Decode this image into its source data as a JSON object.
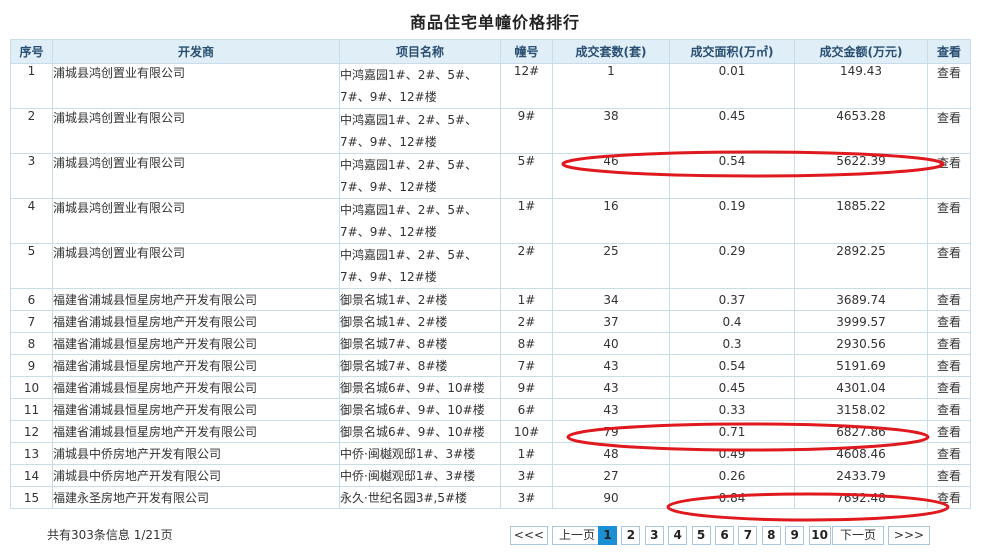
{
  "page_title": "商品住宅单幢价格排行",
  "columns": [
    "序号",
    "开发商",
    "项目名称",
    "幢号",
    "成交套数(套)",
    "成交面积(万㎡)",
    "成交金额(万元)",
    "查看"
  ],
  "rows": [
    {
      "no": "1",
      "developer": "浦城县鸿创置业有限公司",
      "project_line1": "中鸿嘉园1#、2#、5#、",
      "project_line2": "7#、9#、12#楼",
      "building": "12#",
      "units": "1",
      "area": "0.01",
      "amount": "149.43",
      "view": "查看"
    },
    {
      "no": "2",
      "developer": "浦城县鸿创置业有限公司",
      "project_line1": "中鸿嘉园1#、2#、5#、",
      "project_line2": "7#、9#、12#楼",
      "building": "9#",
      "units": "38",
      "area": "0.45",
      "amount": "4653.28",
      "view": "查看"
    },
    {
      "no": "3",
      "developer": "浦城县鸿创置业有限公司",
      "project_line1": "中鸿嘉园1#、2#、5#、",
      "project_line2": "7#、9#、12#楼",
      "building": "5#",
      "units": "46",
      "area": "0.54",
      "amount": "5622.39",
      "view": "查看"
    },
    {
      "no": "4",
      "developer": "浦城县鸿创置业有限公司",
      "project_line1": "中鸿嘉园1#、2#、5#、",
      "project_line2": "7#、9#、12#楼",
      "building": "1#",
      "units": "16",
      "area": "0.19",
      "amount": "1885.22",
      "view": "查看"
    },
    {
      "no": "5",
      "developer": "浦城县鸿创置业有限公司",
      "project_line1": "中鸿嘉园1#、2#、5#、",
      "project_line2": "7#、9#、12#楼",
      "building": "2#",
      "units": "25",
      "area": "0.29",
      "amount": "2892.25",
      "view": "查看"
    },
    {
      "no": "6",
      "developer": "福建省浦城县恒星房地产开发有限公司",
      "project_line1": "御景名城1#、2#楼",
      "project_line2": "",
      "building": "1#",
      "units": "34",
      "area": "0.37",
      "amount": "3689.74",
      "view": "查看"
    },
    {
      "no": "7",
      "developer": "福建省浦城县恒星房地产开发有限公司",
      "project_line1": "御景名城1#、2#楼",
      "project_line2": "",
      "building": "2#",
      "units": "37",
      "area": "0.4",
      "amount": "3999.57",
      "view": "查看"
    },
    {
      "no": "8",
      "developer": "福建省浦城县恒星房地产开发有限公司",
      "project_line1": "御景名城7#、8#楼",
      "project_line2": "",
      "building": "8#",
      "units": "40",
      "area": "0.3",
      "amount": "2930.56",
      "view": "查看"
    },
    {
      "no": "9",
      "developer": "福建省浦城县恒星房地产开发有限公司",
      "project_line1": "御景名城7#、8#楼",
      "project_line2": "",
      "building": "7#",
      "units": "43",
      "area": "0.54",
      "amount": "5191.69",
      "view": "查看"
    },
    {
      "no": "10",
      "developer": "福建省浦城县恒星房地产开发有限公司",
      "project_line1": "御景名城6#、9#、10#楼",
      "project_line2": "",
      "building": "9#",
      "units": "43",
      "area": "0.45",
      "amount": "4301.04",
      "view": "查看"
    },
    {
      "no": "11",
      "developer": "福建省浦城县恒星房地产开发有限公司",
      "project_line1": "御景名城6#、9#、10#楼",
      "project_line2": "",
      "building": "6#",
      "units": "43",
      "area": "0.33",
      "amount": "3158.02",
      "view": "查看"
    },
    {
      "no": "12",
      "developer": "福建省浦城县恒星房地产开发有限公司",
      "project_line1": "御景名城6#、9#、10#楼",
      "project_line2": "",
      "building": "10#",
      "units": "79",
      "area": "0.71",
      "amount": "6827.86",
      "view": "查看"
    },
    {
      "no": "13",
      "developer": "浦城县中侨房地产开发有限公司",
      "project_line1": "中侨·闽樾观邸1#、3#楼",
      "project_line2": "",
      "building": "1#",
      "units": "48",
      "area": "0.49",
      "amount": "4608.46",
      "view": "查看"
    },
    {
      "no": "14",
      "developer": "浦城县中侨房地产开发有限公司",
      "project_line1": "中侨·闽樾观邸1#、3#楼",
      "project_line2": "",
      "building": "3#",
      "units": "27",
      "area": "0.26",
      "amount": "2433.79",
      "view": "查看"
    },
    {
      "no": "15",
      "developer": "福建永圣房地产开发有限公司",
      "project_line1": "永久·世纪名园3#,5#楼",
      "project_line2": "",
      "building": "3#",
      "units": "90",
      "area": "0.84",
      "amount": "7692.48",
      "view": "查看"
    }
  ],
  "footer": {
    "total_info": "共有303条信息 1/21页"
  },
  "pagination": {
    "first": "<<<",
    "prev": "上一页",
    "pages": [
      "1",
      "2",
      "3",
      "4",
      "5",
      "6",
      "7",
      "8",
      "9",
      "10"
    ],
    "active_page": "1",
    "next": "下一页",
    "last": ">>>"
  },
  "colors": {
    "header_bg": "#dfeef7",
    "border": "#c9dde9",
    "active_page_bg": "#1a8fd4",
    "annotation": "#e0191e"
  }
}
